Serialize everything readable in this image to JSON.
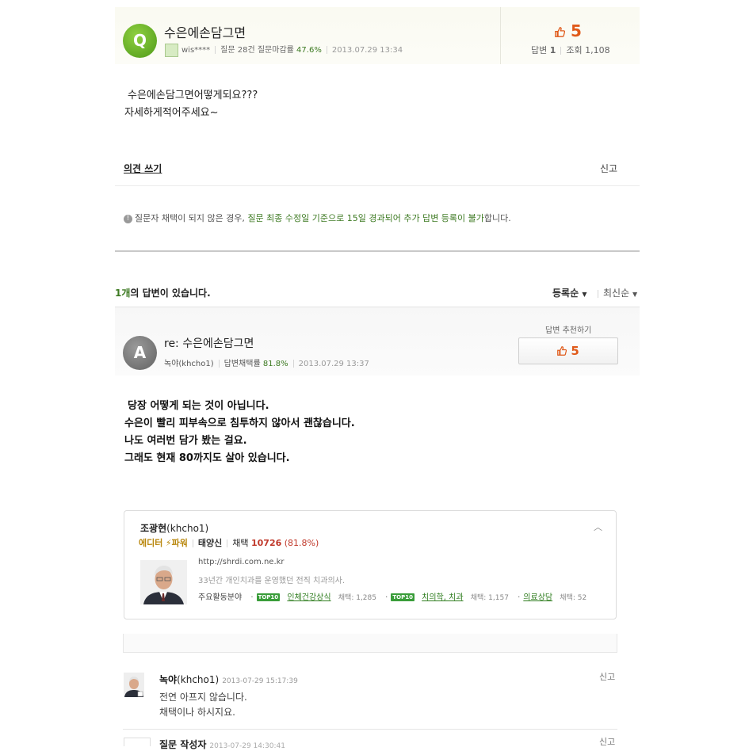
{
  "question": {
    "badge": "Q",
    "title": "수은에손담그면",
    "author": "wis****",
    "question_stats": "질문 28건 질문마감률",
    "close_rate": "47.6%",
    "date": "2013.07.29 13:34",
    "recommend_count": "5",
    "answers_label": "답변",
    "answers_count": "1",
    "views_label": "조회",
    "views_count": "1,108",
    "body_line1": "수은에손담그면어떻게되요???",
    "body_line2": "자세하게적어주세요~"
  },
  "actions": {
    "opinion_link": "의견 쓰기",
    "report": "신고"
  },
  "notice": {
    "prefix": "질문자 채택이 되지 않은 경우,",
    "highlight": "질문 최종 수정일 기준으로 15일 경과되어 추가 답변 등록이 불가",
    "suffix": "합니다."
  },
  "answers_header": {
    "count": "1개",
    "suffix": "의 답변이 있습니다.",
    "sort_registered": "등록순",
    "sort_latest": "최신순"
  },
  "answer": {
    "badge": "A",
    "title": "re: 수은에손담그면",
    "author": "녹야(khcho1)",
    "adopt_label": "답변채택률",
    "adopt_rate": "81.8%",
    "date": "2013.07.29 13:37",
    "recommend_label": "답변 추천하기",
    "recommend_count": "5",
    "body": [
      "당장 어떻게 되는 것이 아닙니다.",
      "수은이 빨리 피부속으로 침투하지 않아서 괜찮습니다.",
      "나도 여러번 담가 봤는 걸요.",
      "그래도 현재 80까지도 살아 있습니다."
    ]
  },
  "profile": {
    "name": "조광현",
    "id": "(khcho1)",
    "editor": "에디터",
    "power": "파워",
    "tier": "태양신",
    "adopt_label": "채택",
    "adopt_count": "10726",
    "adopt_pct": "(81.8%)",
    "url": "http://shrdi.com.ne.kr",
    "desc": "33년간 개인치과를 운영했던 전직 치과의사.",
    "fields_label": "주요활동분야",
    "top10": "TOP10",
    "fields": [
      {
        "name": "인체건강상식",
        "adopt": "채택: 1,285",
        "top10": true
      },
      {
        "name": "치의학, 치과",
        "adopt": "채택: 1,157",
        "top10": true
      },
      {
        "name": "의료상담",
        "adopt": "채택: 52",
        "top10": false
      }
    ]
  },
  "comments": [
    {
      "name": "녹야",
      "id": "(khcho1)",
      "time": "2013-07-29 15:17:39",
      "report": "신고",
      "line1": "전연 아프지 않습니다.",
      "line2": "채택이나 하시지요."
    },
    {
      "name": "질문 작성자",
      "time": "2013-07-29 14:30:41",
      "report": "신고"
    }
  ]
}
